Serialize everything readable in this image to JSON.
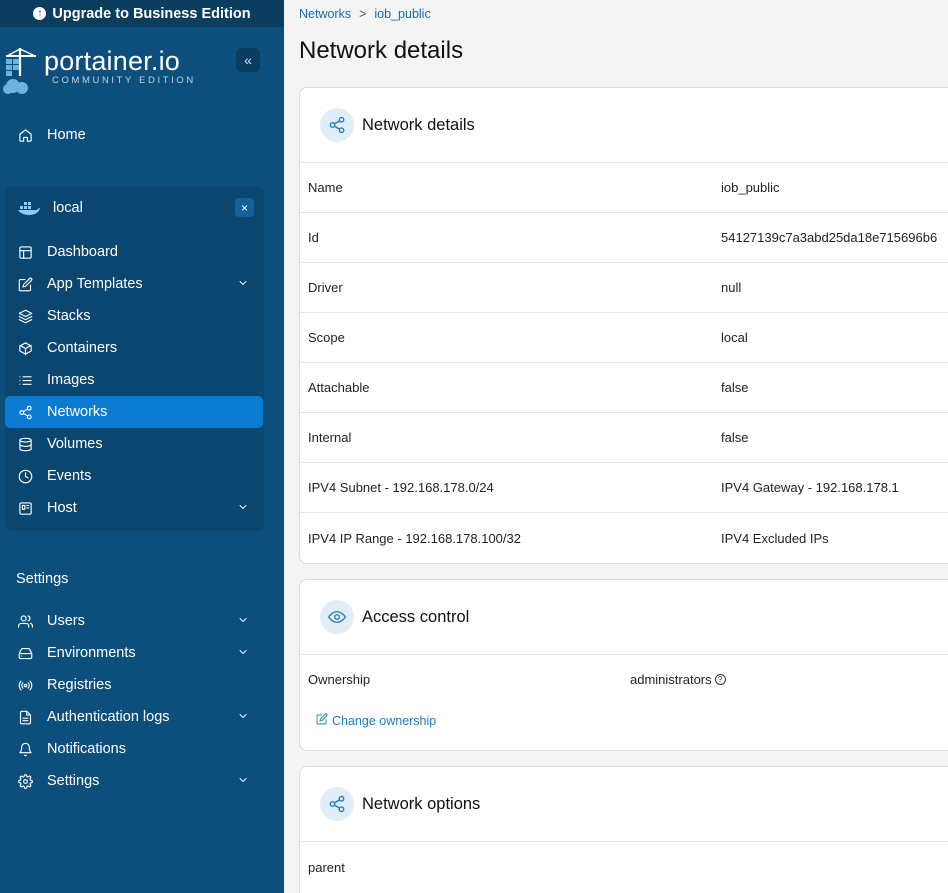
{
  "upgrade": {
    "label": "Upgrade to Business Edition"
  },
  "brand": {
    "name": "portainer.io",
    "edition": "COMMUNITY EDITION"
  },
  "nav": {
    "home": "Home",
    "environment": {
      "name": "local"
    },
    "env_items": [
      {
        "label": "Dashboard",
        "icon": "dashboard-icon"
      },
      {
        "label": "App Templates",
        "icon": "edit-icon",
        "expandable": true
      },
      {
        "label": "Stacks",
        "icon": "layers-icon"
      },
      {
        "label": "Containers",
        "icon": "box-icon"
      },
      {
        "label": "Images",
        "icon": "list-icon"
      },
      {
        "label": "Networks",
        "icon": "share-icon",
        "active": true
      },
      {
        "label": "Volumes",
        "icon": "database-icon"
      },
      {
        "label": "Events",
        "icon": "clock-icon"
      },
      {
        "label": "Host",
        "icon": "server-icon",
        "expandable": true
      }
    ],
    "settings_section": "Settings",
    "settings_items": [
      {
        "label": "Users",
        "icon": "users-icon",
        "expandable": true
      },
      {
        "label": "Environments",
        "icon": "hdd-icon",
        "expandable": true
      },
      {
        "label": "Registries",
        "icon": "radio-icon"
      },
      {
        "label": "Authentication logs",
        "icon": "file-icon",
        "expandable": true
      },
      {
        "label": "Notifications",
        "icon": "bell-icon"
      },
      {
        "label": "Settings",
        "icon": "gear-icon",
        "expandable": true
      }
    ]
  },
  "breadcrumb": {
    "root": "Networks",
    "separator": ">",
    "current": "iob_public"
  },
  "page": {
    "title": "Network details"
  },
  "details_card": {
    "title": "Network details",
    "rows": [
      {
        "key": "Name",
        "value": "iob_public"
      },
      {
        "key": "Id",
        "value": "54127139c7a3abd25da18e715696b6"
      },
      {
        "key": "Driver",
        "value": "null"
      },
      {
        "key": "Scope",
        "value": "local"
      },
      {
        "key": "Attachable",
        "value": "false"
      },
      {
        "key": "Internal",
        "value": "false"
      },
      {
        "key": "IPV4 Subnet - 192.168.178.0/24",
        "value": "IPV4 Gateway - 192.168.178.1"
      },
      {
        "key": "IPV4 IP Range - 192.168.178.100/32",
        "value": "IPV4 Excluded IPs"
      }
    ]
  },
  "access_card": {
    "title": "Access control",
    "ownership_label": "Ownership",
    "ownership_value": "administrators",
    "help_glyph": "?",
    "change_label": "Change ownership"
  },
  "options_card": {
    "title": "Network options",
    "rows": [
      {
        "key": "parent"
      }
    ]
  },
  "colors": {
    "sidebar": "#0d4f7c",
    "active": "#0a7bd1",
    "accent": "#1a7fc1"
  }
}
